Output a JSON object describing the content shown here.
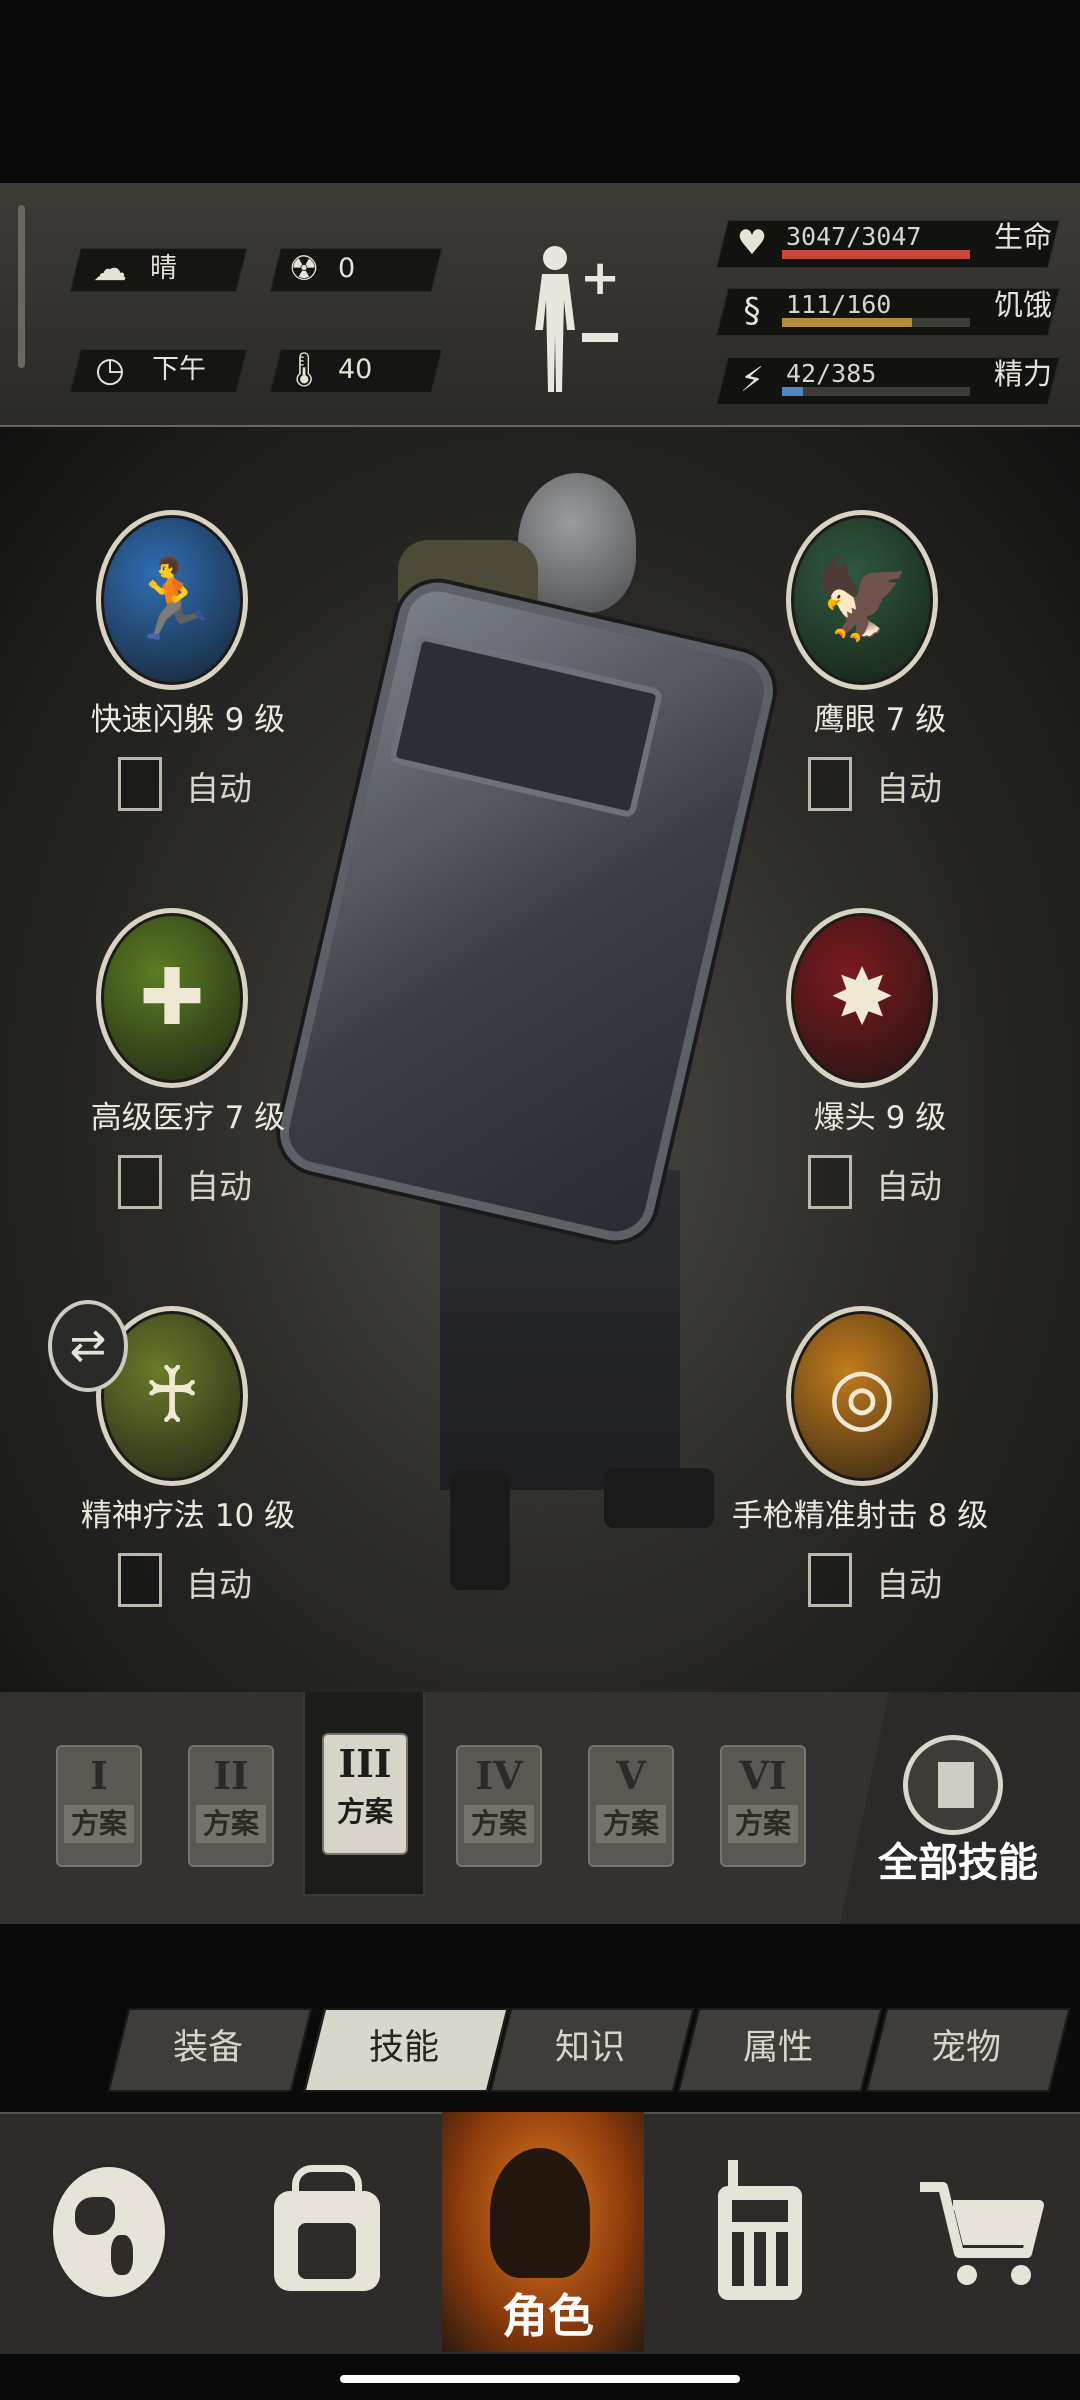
{
  "status": {
    "weather": {
      "icon": "cloud-icon",
      "label": "晴"
    },
    "radiation": {
      "icon": "radiation-icon",
      "value": "0"
    },
    "time": {
      "icon": "clock-icon",
      "label": "下午"
    },
    "temperature": {
      "icon": "thermometer-icon",
      "value": "40"
    },
    "stats": [
      {
        "name": "health",
        "icon": "heart-icon",
        "value": "3047/3047",
        "label": "生命",
        "fraction": 1.0,
        "color": "#c9473a"
      },
      {
        "name": "hunger",
        "icon": "stomach-icon",
        "value": "111/160",
        "label": "饥饿",
        "fraction": 0.69,
        "color": "#b58c3d"
      },
      {
        "name": "energy",
        "icon": "energy-icon",
        "value": "42/385",
        "label": "精力",
        "fraction": 0.11,
        "color": "#4f86c6"
      }
    ]
  },
  "skills": [
    {
      "name": "快速闪躲 9 级",
      "auto": "自动",
      "icon": "dodge-icon",
      "color": "#2f6eb3"
    },
    {
      "name": "鹰眼 7 级",
      "auto": "自动",
      "icon": "eagle-eye-icon",
      "color": "#2f5a3e"
    },
    {
      "name": "高级医疗 7 级",
      "auto": "自动",
      "icon": "medical-icon",
      "color": "#5b7d23"
    },
    {
      "name": "爆头 9 级",
      "auto": "自动",
      "icon": "headshot-icon",
      "color": "#7a1b1f"
    },
    {
      "name": "精神疗法 10 级",
      "auto": "自动",
      "icon": "mental-therapy-icon",
      "color": "#6b7a2a"
    },
    {
      "name": "手枪精准射击 8 级",
      "auto": "自动",
      "icon": "pistol-shot-icon",
      "color": "#c27c1d"
    }
  ],
  "plans": [
    {
      "roman": "I",
      "label": "方案"
    },
    {
      "roman": "II",
      "label": "方案"
    },
    {
      "roman": "III",
      "label": "方案"
    },
    {
      "roman": "IV",
      "label": "方案"
    },
    {
      "roman": "V",
      "label": "方案"
    },
    {
      "roman": "VI",
      "label": "方案"
    }
  ],
  "all_skills_label": "全部技能",
  "tabs": [
    "装备",
    "技能",
    "知识",
    "属性",
    "宠物"
  ],
  "active_tab": 1,
  "nav": {
    "items": [
      "globe-icon",
      "backpack-icon",
      "character-icon",
      "radio-icon",
      "cart-icon"
    ],
    "center_label": "角色"
  }
}
